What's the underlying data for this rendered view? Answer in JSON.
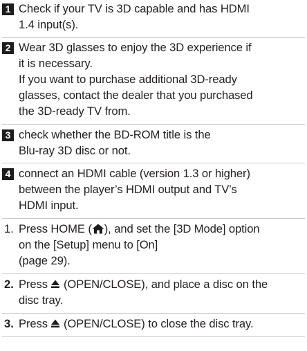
{
  "checks": [
    {
      "badge": "1",
      "lines": [
        "Check if your TV is 3D capable and has HDMI",
        "1.4 input(s)."
      ]
    },
    {
      "badge": "2",
      "lines": [
        "Wear 3D glasses to enjoy the 3D experience if",
        "it is necessary.",
        "If you want to purchase additional 3D-ready",
        "glasses, contact the dealer that you purchased",
        "the 3D-ready TV from."
      ]
    },
    {
      "badge": "3",
      "lines": [
        "check whether the BD-ROM title is the",
        "Blu-ray 3D disc or not."
      ]
    },
    {
      "badge": "4",
      "lines": [
        "connect an HDMI cable (version 1.3 or higher)",
        "between the player’s HDMI output and TV’s",
        "HDMI input."
      ]
    }
  ],
  "steps": [
    {
      "num": "1.",
      "line1_before": "Press HOME (",
      "line1_after": "), and set the [3D Mode] option",
      "line2": "on the [Setup] menu to [On]",
      "line3": "(page 29).",
      "icon": "home-icon"
    },
    {
      "num": "2.",
      "line1_before": "Press ",
      "line1_after": " (OPEN/CLOSE), and place a disc on the",
      "line2": "disc tray.",
      "icon": "eject-icon"
    },
    {
      "num": "3.",
      "line1_before": "Press ",
      "line1_after": " (OPEN/CLOSE) to close the disc tray.",
      "icon": "eject-icon"
    }
  ]
}
